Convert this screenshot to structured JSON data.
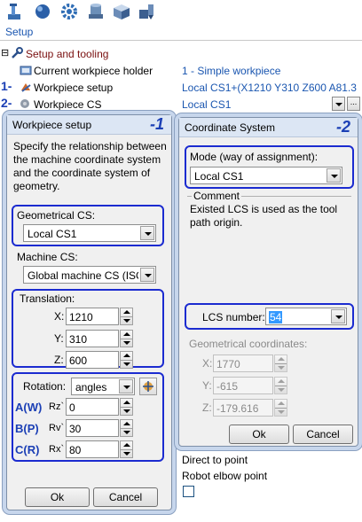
{
  "toolbar": {
    "icons": [
      "setup-machine-icon",
      "sphere-icon",
      "gear-icon",
      "cylinder-stack-icon",
      "cube-icon",
      "workpiece-tool-icon"
    ],
    "tab_label": "Setup"
  },
  "tree": {
    "rows": [
      {
        "label": "Setup and tooling",
        "value": ""
      },
      {
        "label": "Current workpiece holder",
        "value": "1 - Simple workpiece"
      },
      {
        "label": "Workpiece setup",
        "value": "Local CS1+(X1210 Y310 Z600 A81.3"
      },
      {
        "label": "Workpiece CS",
        "value": "Local CS1"
      }
    ],
    "markers": [
      "1-",
      "2-"
    ],
    "expand_symbol": "⊟",
    "extra_items": [
      "Direct to point",
      "Robot elbow point"
    ]
  },
  "workpiece_setup": {
    "title": "Workpiece setup",
    "number": "-1",
    "description": "Specify the relationship between the machine coordinate system and the coordinate system of geometry.",
    "geometrical_cs_label": "Geometrical CS:",
    "geometrical_cs_value": "Local CS1",
    "machine_cs_label": "Machine CS:",
    "machine_cs_value": "Global machine CS (ISO",
    "translation_label": "Translation:",
    "x_label": "X:",
    "x_value": "1210",
    "y_label": "Y:",
    "y_value": "310",
    "z_label": "Z:",
    "z_value": "600",
    "rotation_label": "Rotation:",
    "rotation_mode": "angles",
    "aw_label": "A(W)",
    "aw_axis": "Rz`",
    "aw_value": "0",
    "bp_label": "B(P)",
    "bp_axis": "Rv`",
    "bp_value": "30",
    "cr_label": "C(R)",
    "cr_axis": "Rx`",
    "cr_value": "80",
    "ok_label": "Ok",
    "cancel_label": "Cancel"
  },
  "coordinate_system": {
    "title": "Coordinate System",
    "number": "-2",
    "mode_label": "Mode (way of assignment):",
    "mode_value": "Local CS1",
    "comment_label": "Comment",
    "comment_text": "Existed LCS is used as the tool path origin.",
    "lcs_label": "LCS number:",
    "lcs_value": "54",
    "geom_label": "Geometrical coordinates:",
    "x_label": "X:",
    "x_value": "1770",
    "y_label": "Y:",
    "y_value": "-615",
    "z_label": "Z:",
    "z_value": "-179.616",
    "ok_label": "Ok",
    "cancel_label": "Cancel"
  },
  "colors": {
    "accent_blue": "#1b2bd0",
    "link_blue": "#1a56b0",
    "tree_darkred": "#7a1010",
    "dialog_bg": "#f0f0f0"
  }
}
